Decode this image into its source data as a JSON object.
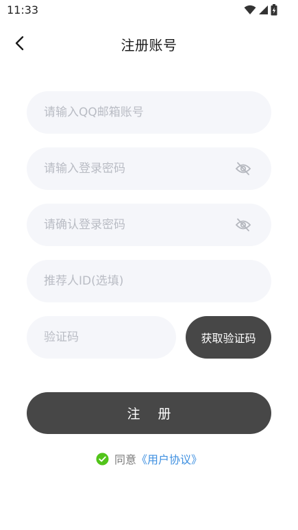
{
  "status_bar": {
    "time": "11:33",
    "icons": [
      "wifi-icon",
      "signal-icon",
      "battery-icon"
    ]
  },
  "header": {
    "title": "注册账号",
    "back_icon": "chevron-left-icon"
  },
  "form": {
    "email_placeholder": "请输入QQ邮箱账号",
    "password_placeholder": "请输入登录密码",
    "confirm_password_placeholder": "请确认登录密码",
    "referrer_placeholder": "推荐人ID(选填)",
    "code_placeholder": "验证码",
    "get_code_label": "获取验证码",
    "password_toggle_icon": "eye-off-icon"
  },
  "register_label": "注册",
  "agreement": {
    "prefix": "同意",
    "link": "《用户协议》",
    "checked": true
  },
  "colors": {
    "button_bg": "#474747",
    "field_bg": "#f5f6fa",
    "placeholder": "#b9bcc4",
    "link": "#3d8fe0",
    "check": "#52c41a"
  }
}
